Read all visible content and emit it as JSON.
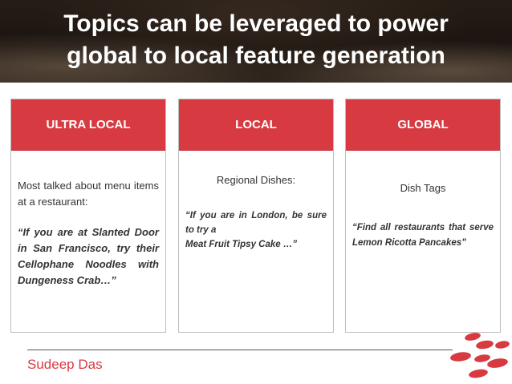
{
  "slide": {
    "title_line1": "Topics can be leveraged to power",
    "title_line2": "global to local feature generation",
    "author": "Sudeep Das"
  },
  "cards": [
    {
      "heading": "ULTRA LOCAL",
      "lead": "Most talked about menu items at a restaurant:",
      "quote": "“If you are at Slanted Door in San Francisco, try their Cellophane Noodles with Dungeness Crab…”"
    },
    {
      "heading": "LOCAL",
      "lead": "Regional Dishes:",
      "quote_line1": "“If you are in London, be sure to try a",
      "quote_line2": "Meat Fruit Tipsy Cake …”"
    },
    {
      "heading": "GLOBAL",
      "lead": "Dish Tags",
      "quote": "“Find all restaurants that serve Lemon Ricotta Pancakes”"
    }
  ],
  "colors": {
    "accent": "#d83a41",
    "header_bg": "#2b2019",
    "text": "#333333"
  },
  "icons": {
    "logo": "red-dots-logo"
  }
}
